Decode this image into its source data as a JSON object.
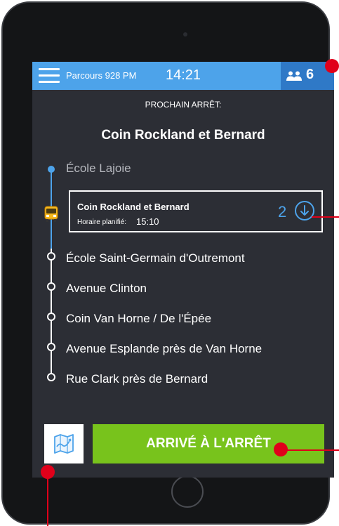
{
  "header": {
    "route": "Parcours 928 PM",
    "time": "14:21",
    "passenger_count": "6"
  },
  "next": {
    "label": "PROCHAIN ARRÊT:",
    "stop_name": "Coin Rockland et Bernard"
  },
  "timeline": {
    "previous_stop": "École Lajoie",
    "current": {
      "name": "Coin Rockland et Bernard",
      "schedule_label": "Horaire planifié:",
      "schedule_time": "15:10",
      "count": "2"
    },
    "upcoming": [
      "École Saint-Germain d'Outremont",
      "Avenue Clinton",
      "Coin Van Horne / De l'Épée",
      "Avenue Esplande près de Van Horne",
      "Rue Clark près de Bernard"
    ]
  },
  "actions": {
    "arrive_label": "ARRIVÉ À L'ARRÊT"
  },
  "colors": {
    "accent_blue": "#4da3ea",
    "arrive_green": "#78c31c",
    "annotation_red": "#e0001a"
  }
}
